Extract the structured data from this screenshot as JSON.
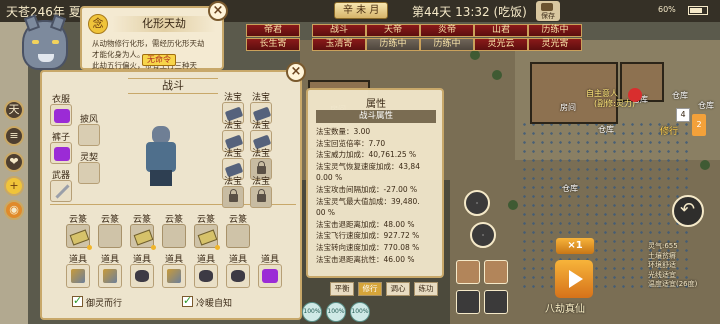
{
  "top": {
    "era": "天苍246年 夏",
    "date_badge": "辛 未 月",
    "day": "第44天 13:32 (吃饭)",
    "save_label": "保存",
    "battery": "60%"
  },
  "faction_tags": [
    {
      "label": "帝君",
      "style": "red"
    },
    {
      "label": "战斗",
      "style": "red"
    },
    {
      "label": "天帝",
      "style": "red"
    },
    {
      "label": "炎帝",
      "style": "red"
    },
    {
      "label": "山君",
      "style": "red"
    },
    {
      "label": "历练中",
      "style": "red"
    },
    {
      "label": "长生寄",
      "style": "red"
    },
    {
      "label": "玉清寄",
      "style": "red"
    },
    {
      "label": "历练中",
      "style": "gray"
    },
    {
      "label": "历练中",
      "style": "gray"
    },
    {
      "label": "灵光云",
      "style": "red"
    },
    {
      "label": "灵光寄",
      "style": "red"
    }
  ],
  "side_menu": [
    {
      "icon": "天",
      "name": "sky-icon"
    },
    {
      "icon": "≡",
      "name": "menu-icon"
    },
    {
      "icon": "❤",
      "name": "heart-icon"
    },
    {
      "icon": "+",
      "name": "plus-icon"
    },
    {
      "icon": "◉",
      "name": "orb-icon"
    }
  ],
  "quest": {
    "icon": "念",
    "title": "化形天劫",
    "body_lines": [
      "从动物修行化形，需经历化形天劫",
      "才能化身为人。",
      "此劫五行偏火，带有土行三种天"
    ],
    "stamp": "无命令"
  },
  "combat": {
    "title": "战斗",
    "left_slots": [
      {
        "label": "衣服",
        "glyph": "purple"
      },
      {
        "label": "裤子",
        "glyph": "purple"
      },
      {
        "label": "武器",
        "glyph": "blade"
      }
    ],
    "mid_slots": [
      {
        "label": "披风"
      },
      {
        "label": "灵契"
      }
    ],
    "treasure_label": "法宝",
    "treasures": [
      {
        "col": 0,
        "row": 0,
        "state": "scroll"
      },
      {
        "col": 1,
        "row": 0,
        "state": "scroll"
      },
      {
        "col": 0,
        "row": 1,
        "state": "scroll"
      },
      {
        "col": 1,
        "row": 1,
        "state": "scroll"
      },
      {
        "col": 0,
        "row": 2,
        "state": "scroll"
      },
      {
        "col": 1,
        "row": 2,
        "state": "locked"
      },
      {
        "col": 0,
        "row": 3,
        "state": "locked"
      },
      {
        "col": 1,
        "row": 3,
        "state": "locked"
      }
    ],
    "cloud_label": "云篆",
    "clouds": [
      true,
      false,
      true,
      false,
      true,
      false
    ],
    "tool_label": "道具",
    "tools": [
      "tile",
      "tile",
      "dark",
      "tile",
      "dark",
      "dark",
      "purple"
    ],
    "checks": [
      {
        "label": "御灵而行"
      },
      {
        "label": "冷暖自知"
      }
    ]
  },
  "attributes": {
    "title": "属性",
    "subtitle": "战斗属性",
    "rows": [
      "法宝数量：3.00",
      "法宝回览倍率：7.70",
      "法宝威力加成：40,761.25 %",
      "法宝灵气恢复速度加成：43,84",
      "0.00 %",
      "法宝攻击间隔加成：-27.00 %",
      "法宝灵气最大值加成：39,480.",
      "00 %",
      "法宝击退距离加成：48.00 %",
      "法宝飞行速度加成：927.72 %",
      "法宝转向速度加成：770.08 %",
      "法宝击退距离抗性：46.00 %"
    ]
  },
  "bottom": {
    "mode_buttons": [
      "平衡",
      "修行",
      "调心",
      "练功"
    ],
    "active_mode": 1,
    "percent_bubbles": [
      "100%",
      "100%",
      "100%"
    ],
    "footer_left": [
      "自修",
      "队列"
    ]
  },
  "right": {
    "speed": "×1",
    "play_label": "八劫真仙",
    "info_lines": [
      "灵气:655",
      "土壤贫瘠",
      "环境舒适",
      "光线适宜",
      "温度适宜(26度)"
    ],
    "mini_labels": [
      "自主意人",
      "(副修:灵力)"
    ],
    "xiu": "修行",
    "badge1": "4",
    "badge2": "2",
    "room_labels": [
      "房间",
      "仓库",
      "仓库",
      "房间",
      "仓库",
      "仓库",
      "仓库"
    ]
  }
}
